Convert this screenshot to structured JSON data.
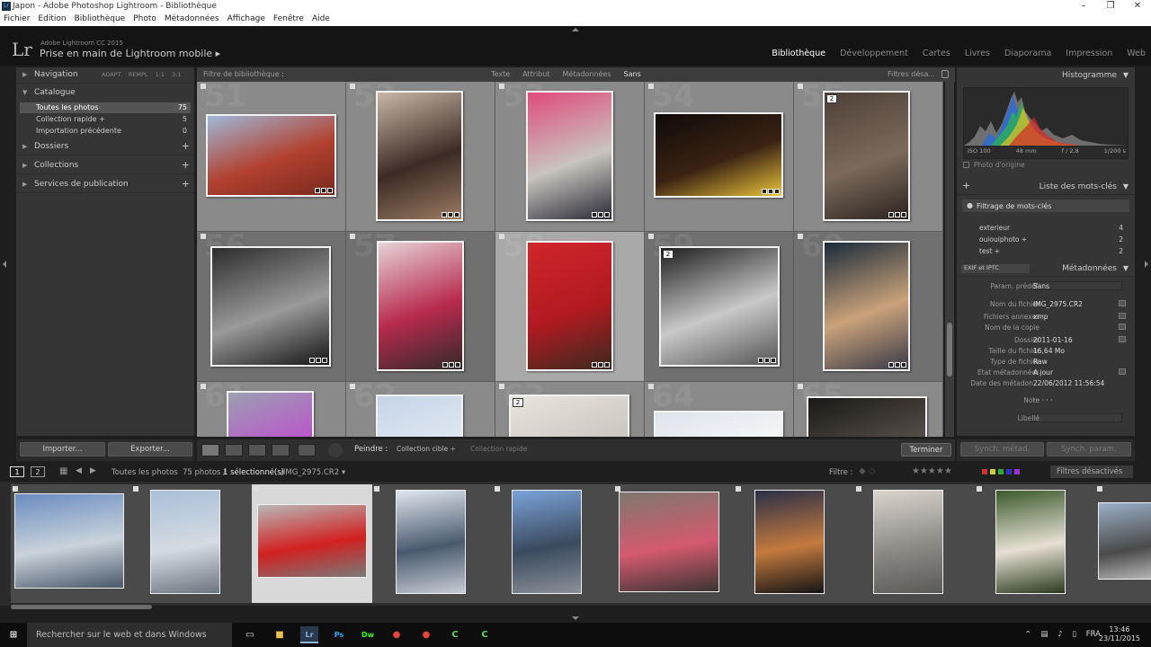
{
  "window": {
    "title": "Japon - Adobe Photoshop Lightroom - Bibliothèque",
    "controls": [
      "–",
      "❐",
      "✕"
    ]
  },
  "menu": [
    "Fichier",
    "Edition",
    "Bibliothèque",
    "Photo",
    "Métadonnées",
    "Affichage",
    "Fenêtre",
    "Aide"
  ],
  "identity": {
    "logo": "Lr",
    "product": "Adobe Lightroom CC 2015",
    "title": "Prise en main de Lightroom mobile ▸"
  },
  "modules": [
    {
      "label": "Bibliothèque",
      "active": true
    },
    {
      "label": "Développement",
      "active": false
    },
    {
      "label": "Cartes",
      "active": false
    },
    {
      "label": "Livres",
      "active": false
    },
    {
      "label": "Diaporama",
      "active": false
    },
    {
      "label": "Impression",
      "active": false
    },
    {
      "label": "Web",
      "active": false
    }
  ],
  "left_panel": {
    "navigation": {
      "label": "Navigation",
      "options": "ADAPT REMPL 1:1 3:1"
    },
    "catalogue": {
      "label": "Catalogue",
      "items": [
        {
          "label": "Toutes les photos",
          "count": "75",
          "selected": true
        },
        {
          "label": "Collection rapide +",
          "count": "5",
          "selected": false
        },
        {
          "label": "Importation précédente",
          "count": "0",
          "selected": false
        }
      ]
    },
    "dossiers": "Dossiers",
    "collections": "Collections",
    "services": "Services de publication",
    "import_btn": "Importer...",
    "export_btn": "Exporter..."
  },
  "grid_header": {
    "label": "Filtre de bibliothèque :",
    "filters": [
      {
        "label": "Texte",
        "on": false
      },
      {
        "label": "Attribut",
        "on": false
      },
      {
        "label": "Métadonnées",
        "on": false
      },
      {
        "label": "Sans",
        "on": true
      }
    ],
    "filters_off": "Filtres désa..."
  },
  "grid_cells": [
    {
      "num": "51",
      "bg": "#8a8a8a",
      "colors": [
        "#9fb8d9",
        "#b2412f",
        "#7a2a1e"
      ],
      "stack": ""
    },
    {
      "num": "52",
      "bg": "#8a8a8a",
      "colors": [
        "#c9b8a8",
        "#3b2b24",
        "#9a7b62"
      ],
      "stack": ""
    },
    {
      "num": "53",
      "bg": "#8a8a8a",
      "colors": [
        "#e04a7c",
        "#c8c4be",
        "#2a2a36"
      ],
      "stack": ""
    },
    {
      "num": "54",
      "bg": "#8a8a8a",
      "colors": [
        "#0e0b09",
        "#3a2213",
        "#e9c33a"
      ],
      "stack": ""
    },
    {
      "num": "55",
      "bg": "#8a8a8a",
      "colors": [
        "#4e4038",
        "#7b6a5c",
        "#2c231e"
      ],
      "stack": "2"
    },
    {
      "num": "56",
      "bg": "#707070",
      "colors": [
        "#2c2c2c",
        "#9a9a9a",
        "#151515"
      ],
      "stack": ""
    },
    {
      "num": "57",
      "bg": "#707070",
      "colors": [
        "#e6d2d8",
        "#b82a4c",
        "#302a2a"
      ],
      "stack": ""
    },
    {
      "num": "58",
      "bg": "#a9a9a9",
      "colors": [
        "#d0262a",
        "#b11a20",
        "#3a2a1e"
      ],
      "stack": ""
    },
    {
      "num": "59",
      "bg": "#707070",
      "colors": [
        "#1e1e1e",
        "#c9c9c9",
        "#555"
      ],
      "stack": "2"
    },
    {
      "num": "60",
      "bg": "#707070",
      "colors": [
        "#1a2a3a",
        "#c9a27a",
        "#3a3a48"
      ],
      "stack": ""
    },
    {
      "num": "61",
      "bg": "#8a8a8a",
      "colors": [
        "#9aa0b0",
        "#c04ad0",
        "#c9a8d4"
      ],
      "stack": ""
    },
    {
      "num": "62",
      "bg": "#8a8a8a",
      "colors": [
        "#c6d4e6",
        "#e4ecf4",
        "#aab8cc"
      ],
      "stack": ""
    },
    {
      "num": "63",
      "bg": "#8a8a8a",
      "colors": [
        "#e8e4de",
        "#c9c4bd",
        "#8a857e"
      ],
      "stack": "2"
    },
    {
      "num": "64",
      "bg": "#8a8a8a",
      "colors": [
        "#dfe4ea",
        "#f4f6f8",
        "#c4cbd4"
      ],
      "stack": ""
    },
    {
      "num": "65",
      "bg": "#8a8a8a",
      "colors": [
        "#1a1816",
        "#5a534c",
        "#0e0d0c"
      ],
      "stack": ""
    }
  ],
  "right_panel": {
    "histogram": {
      "label": "Histogramme",
      "iso": "ISO 100",
      "focal": "48 mm",
      "aperture": "f / 2,8",
      "shutter": "1/200 s",
      "original": "Photo d'origine"
    },
    "keywords": {
      "label": "Liste des mots-clés",
      "filter": "Filtrage de mots-clés",
      "items": [
        {
          "label": "exterieur",
          "count": "4"
        },
        {
          "label": "ouiouiphoto +",
          "count": "2"
        },
        {
          "label": "test +",
          "count": "2"
        }
      ]
    },
    "metadata": {
      "label": "Métadonnées",
      "preset_dropdown": "EXIF et IPTC",
      "rows": [
        {
          "k": "Param. prédéf.",
          "v": "Sans"
        },
        {
          "k": "Nom du fichier",
          "v": "IMG_2975.CR2"
        },
        {
          "k": "Fichiers annexes",
          "v": "xmp"
        },
        {
          "k": "Nom de la copie",
          "v": ""
        },
        {
          "k": "Dossier",
          "v": "2011-01-16"
        },
        {
          "k": "Taille du fichier",
          "v": "16,64 Mo"
        },
        {
          "k": "Type de fichier",
          "v": "Raw"
        },
        {
          "k": "Etat métadonnées",
          "v": "A jour"
        },
        {
          "k": "Date des métadon...",
          "v": "22/06/2012 11:56:54"
        },
        {
          "k": "Note",
          "v": "· · · · ·"
        },
        {
          "k": "Libellé",
          "v": ""
        }
      ]
    },
    "sync_meta": "Synch. métad.",
    "sync_params": "Synch. param."
  },
  "toolbar": {
    "paint_label": "Peindre :",
    "target": "Collection cible ÷",
    "quick": "Collection rapide",
    "done": "Terminer"
  },
  "filmstrip_header": {
    "page1": "1",
    "page2": "2",
    "source": "Toutes les photos",
    "count_prefix": "75 photos /",
    "count_sel": "1 sélectionné(s)",
    "count_file": "/IMG_2975.CR2 ▾",
    "filter_label": "Filtre :",
    "filters_off": "Filtres désactivés"
  },
  "filmstrip": [
    {
      "colors": [
        "#6a8cc0",
        "#c9d3dc",
        "#4a5868"
      ],
      "selected": false
    },
    {
      "colors": [
        "#a9bfd8",
        "#d4dbe2",
        "#6c7480"
      ],
      "selected": false
    },
    {
      "colors": [
        "#b8b8b8",
        "#d22020",
        "#7a7a7a"
      ],
      "selected": true
    },
    {
      "colors": [
        "#dfe6ee",
        "#4a5a6e",
        "#c6ccd4"
      ],
      "selected": false
    },
    {
      "colors": [
        "#7aa2d8",
        "#3a4a5e",
        "#8a9098"
      ],
      "selected": false
    },
    {
      "colors": [
        "#7e776e",
        "#d45a70",
        "#3a3430"
      ],
      "selected": false
    },
    {
      "colors": [
        "#2a2f48",
        "#c47a3e",
        "#141416"
      ],
      "selected": false
    },
    {
      "colors": [
        "#d9d4cc",
        "#8d8a86",
        "#5a5a58"
      ],
      "selected": false
    },
    {
      "colors": [
        "#3c5a2c",
        "#e6e0d4",
        "#2a3a1e"
      ],
      "selected": false
    },
    {
      "colors": [
        "#9ab0c8",
        "#4a4a4a",
        "#d4d4d4"
      ],
      "selected": false
    }
  ],
  "taskbar": {
    "search": "Rechercher sur le web et dans Windows",
    "tray": "FRA",
    "time": "13:46",
    "date": "23/11/2015"
  }
}
